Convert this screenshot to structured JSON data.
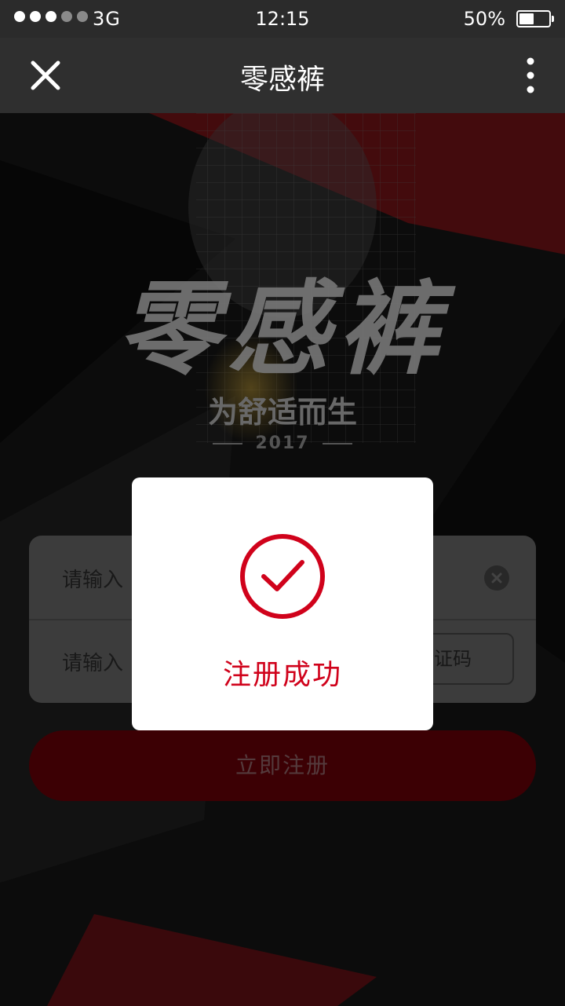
{
  "status_bar": {
    "network": "3G",
    "time": "12:15",
    "battery_percent": "50%",
    "battery_level": 0.5
  },
  "nav": {
    "title": "零感裤",
    "close_icon": "close-icon",
    "more_icon": "more-vertical-icon"
  },
  "hero": {
    "brand": "零感裤",
    "slogan": "为舒适而生",
    "year": "2017"
  },
  "form": {
    "field1_visible_text": "请输入",
    "field2_visible_text": "请输入",
    "code_button_visible_text": "验证码"
  },
  "register_button": "立即注册",
  "modal": {
    "message": "注册成功",
    "icon": "check-circle-icon"
  },
  "colors": {
    "accent": "#d0021b",
    "button": "#8a0010",
    "nav_bg": "#2f2f2f"
  }
}
